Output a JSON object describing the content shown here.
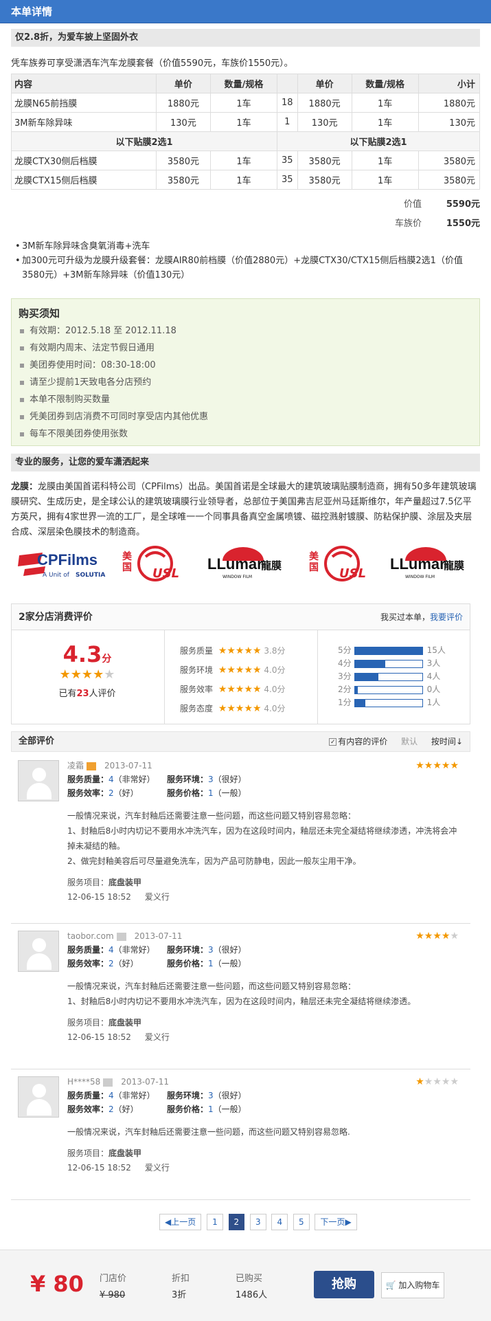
{
  "header": {
    "title": "本单详情"
  },
  "section1": {
    "title": "仅2.8折，为爱车披上坚固外衣",
    "intro": "凭车族券可享受潇洒车汽车龙膜套餐（价值5590元，车族价1550元）。"
  },
  "table": {
    "headers": [
      "内容",
      "单价",
      "数量/规格",
      "",
      "单价",
      "数量/规格",
      "小计"
    ],
    "rows": [
      [
        "龙膜N65前挡膜",
        "1880元",
        "1车",
        "18",
        "1880元",
        "1车",
        "1880元"
      ],
      [
        "3M新车除异味",
        "130元",
        "1车",
        "1",
        "130元",
        "1车",
        "130元"
      ]
    ],
    "sub": [
      "以下贴膜2选1",
      "以下贴膜2选1"
    ],
    "rows2": [
      [
        "龙膜CTX30侧后档膜",
        "3580元",
        "1车",
        "35",
        "3580元",
        "1车",
        "3580元"
      ],
      [
        "龙膜CTX15侧后档膜",
        "3580元",
        "1车",
        "35",
        "3580元",
        "1车",
        "3580元"
      ]
    ]
  },
  "totals": {
    "value_label": "价值",
    "value": "5590元",
    "price_label": "车族价",
    "price": "1550元"
  },
  "bullets": [
    "3M新车除异味含臭氧消毒+洗车",
    "加300元可升级为龙膜升级套餐：龙膜AIR80前档膜（价值2880元）+龙膜CTX30/CTX15侧后档膜2选1（价值3580元）+3M新车除异味（价值130元）"
  ],
  "notice": {
    "title": "购买须知",
    "items": [
      "有效期：2012.5.18 至 2012.11.18",
      "有效期内周末、法定节假日通用",
      "美团券使用时间：08:30-18:00",
      "请至少提前1天致电各分店预约",
      "本单不限制购买数量",
      "凭美团券到店消费不可同时享受店内其他优惠",
      "每车不限美团券使用张数"
    ]
  },
  "section2": {
    "title": "专业的服务，让您的爱车潇洒起来",
    "brand": "龙膜：",
    "desc": "龙膜由美国首诺科特公司（CPFilms）出品。美国首诺是全球最大的建筑玻璃贴膜制造商，拥有50多年建筑玻璃膜研究、生成历史，是全球公认的建筑玻璃膜行业领导者，总部位于美国弗吉尼亚州马廷斯维尔，年产量超过7.5亿平方英尺，拥有4家世界一流的工厂，是全球唯一一个同事具备真空金属喷镀、磁控溅射镀膜、防粘保护膜、涂层及夹层合成、深层染色膜技术的制造商。"
  },
  "logos": {
    "cp": "CPFilms",
    "cp_sub": "A Unit of",
    "cp_sub2": "SOLUTIA",
    "usa": "美国",
    "usl": "USL",
    "llumar": "LLumar",
    "longmo": "龍膜",
    "wf": "WINDOW FILM"
  },
  "reviews_summary": {
    "title": "2家分店消费评价",
    "bought": "我买过本单，",
    "write": "我要评价",
    "score": "4.3",
    "score_unit": "分",
    "count_pre": "已有",
    "count": "23",
    "count_post": "人评价",
    "dims": [
      {
        "label": "服务质量",
        "val": "3.8分"
      },
      {
        "label": "服务环境",
        "val": "4.0分"
      },
      {
        "label": "服务效率",
        "val": "4.0分"
      },
      {
        "label": "服务态度",
        "val": "4.0分"
      }
    ],
    "dist": [
      {
        "label": "5分",
        "count": "15人",
        "frac": 1.0
      },
      {
        "label": "4分",
        "count": "3人",
        "frac": 0.45
      },
      {
        "label": "3分",
        "count": "4人",
        "frac": 0.35
      },
      {
        "label": "2分",
        "count": "0人",
        "frac": 0.04
      },
      {
        "label": "1分",
        "count": "1人",
        "frac": 0.16
      }
    ]
  },
  "all_reviews": {
    "title": "全部评价",
    "opt1": "有内容的评价",
    "opt2": "默认",
    "opt3": "按时间"
  },
  "reviews": [
    {
      "user": "凌霜",
      "date": "2013-07-11",
      "stars": 5,
      "q": "服务质量：",
      "qv": "4",
      "qd": "（非常好）",
      "e": "服务环境：",
      "ev": "3",
      "ed": "（很好）",
      "f": "服务效率：",
      "fv": "2",
      "fd": "（好）",
      "p": "服务价格：",
      "pv": "1",
      "pd": "（一般）",
      "text": [
        "一般情况来说，汽车封釉后还需要注意一些问题，而这些问题又特别容易忽略：",
        "1、封釉后8小时内切记不要用水冲洗汽车，因为在这段时间内，釉层还未完全凝结将继续渗透，冲洗将会冲掉未凝结的釉。",
        "2、做完封釉美容后可尽量避免洗车，因为产品可防静电，因此一般灰尘用干净。"
      ],
      "item_label": "服务项目：",
      "item": "底盘装甲",
      "time": "12-06-15 18:52",
      "shop": "爱义行"
    },
    {
      "user": "taobor.com",
      "date": "2013-07-11",
      "stars": 4,
      "q": "服务质量：",
      "qv": "4",
      "qd": "（非常好）",
      "e": "服务环境：",
      "ev": "3",
      "ed": "（很好）",
      "f": "服务效率：",
      "fv": "2",
      "fd": "（好）",
      "p": "服务价格：",
      "pv": "1",
      "pd": "（一般）",
      "text": [
        "一般情况来说，汽车封釉后还需要注意一些问题，而这些问题又特别容易忽略：",
        "1、封釉后8小时内切记不要用水冲洗汽车，因为在这段时间内，釉层还未完全凝结将继续渗透。"
      ],
      "item_label": "服务项目：",
      "item": "底盘装甲",
      "time": "12-06-15 18:52",
      "shop": "爱义行"
    },
    {
      "user": "H****58",
      "date": "2013-07-11",
      "stars": 1,
      "q": "服务质量：",
      "qv": "4",
      "qd": "（非常好）",
      "e": "服务环境：",
      "ev": "3",
      "ed": "（很好）",
      "f": "服务效率：",
      "fv": "2",
      "fd": "（好）",
      "p": "服务价格：",
      "pv": "1",
      "pd": "（一般）",
      "text": [
        "一般情况来说，汽车封釉后还需要注意一些问题，而这些问题又特别容易忽略."
      ],
      "item_label": "服务项目：",
      "item": "底盘装甲",
      "time": "12-06-15 18:52",
      "shop": "爱义行"
    }
  ],
  "pager": {
    "prev": "上一页",
    "pages": [
      "1",
      "2",
      "3",
      "4",
      "5"
    ],
    "current": "2",
    "next": "下一页"
  },
  "footer": {
    "price": "¥ 80",
    "orig_label": "门店价",
    "orig": "¥ 980",
    "disc_label": "折扣",
    "disc": "3折",
    "sold_label": "已购买",
    "sold": "1486人",
    "buy": "抢购",
    "cart": "加入购物车"
  },
  "colors": {
    "accent": "#3a78c9",
    "price": "#d9232e",
    "star": "#f39800"
  }
}
